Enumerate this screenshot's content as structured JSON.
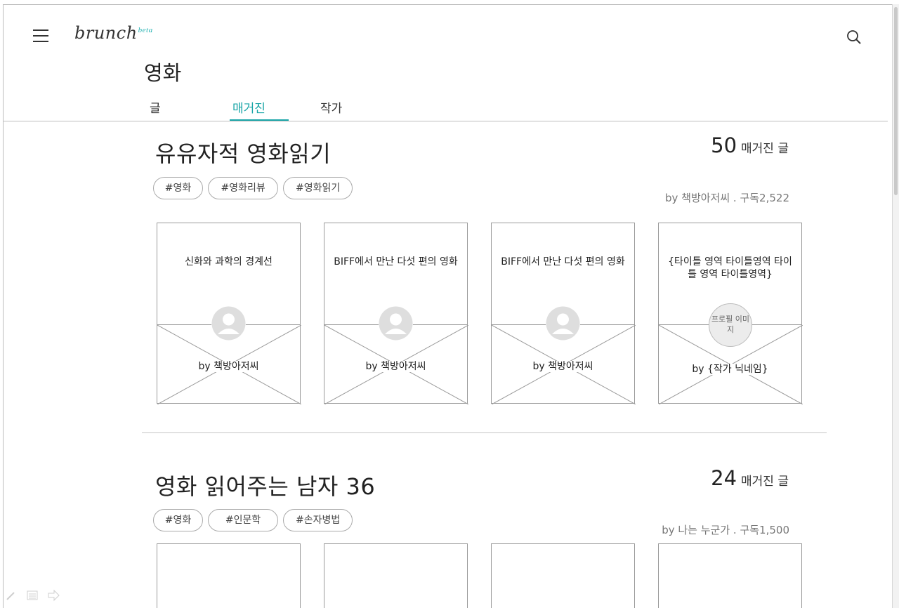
{
  "header": {
    "logo_text": "brunch",
    "logo_badge": "beta"
  },
  "page": {
    "title": "영화"
  },
  "tabs": [
    {
      "label": "글",
      "active": false
    },
    {
      "label": "매거진",
      "active": true
    },
    {
      "label": "작가",
      "active": false
    }
  ],
  "colors": {
    "accent": "#18a5a7",
    "border": "#9a9a9a"
  },
  "magazines": [
    {
      "title": "유유자적 영화읽기",
      "post_count": "50",
      "post_count_label": "매거진 글",
      "tags": [
        "#영화",
        "#영화리뷰",
        "#영화읽기"
      ],
      "byline": "by 책방아저씨 . 구독2,522",
      "cards": [
        {
          "title": "신화와 과학의 경계선",
          "author": "by 책방아저씨"
        },
        {
          "title": "BIFF에서 만난 다섯 편의 영화",
          "author": "by 책방아저씨"
        },
        {
          "title": "BIFF에서 만난 다섯 편의 영화",
          "author": "by 책방아저씨"
        },
        {
          "title": "{타이틀 영역 타이틀영역 타이틀 영역 타이틀영역}",
          "author": "by {작가 닉네임}",
          "avatar_placeholder": "프로필 이미지"
        }
      ]
    },
    {
      "title": "영화 읽어주는 남자 36",
      "post_count": "24",
      "post_count_label": "매거진 글",
      "tags": [
        "#영화",
        "#인문학",
        "#손자병법"
      ],
      "byline": "by 나는 누군가 . 구독1,500"
    }
  ],
  "icons": [
    "menu-icon",
    "search-icon",
    "avatar-icon",
    "pencil-icon",
    "list-icon",
    "arrow-right-icon"
  ]
}
